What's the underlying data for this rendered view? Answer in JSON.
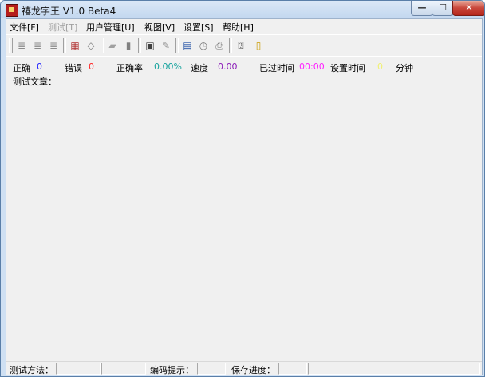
{
  "window": {
    "title": "禧龙字王 V1.0 Beta4",
    "min_glyph": "—",
    "max_glyph": "☐",
    "close_glyph": "✕"
  },
  "menu": [
    {
      "label": "文件[F]",
      "enabled": true
    },
    {
      "label": "测试[T]",
      "enabled": false
    },
    {
      "label": "用户管理[U]",
      "enabled": true
    },
    {
      "label": "视图[V]",
      "enabled": true
    },
    {
      "label": "设置[S]",
      "enabled": true
    },
    {
      "label": "帮助[H]",
      "enabled": true
    }
  ],
  "toolbar": {
    "buttons": [
      {
        "icon": "list-icon-1",
        "glyph": "≣",
        "color": "#8a8a8a"
      },
      {
        "icon": "list-icon-2",
        "glyph": "≣",
        "color": "#8a8a8a"
      },
      {
        "icon": "list-icon-3",
        "glyph": "≣",
        "color": "#8a8a8a"
      },
      {
        "icon": "open-test-icon",
        "glyph": "▦",
        "color": "#b03030"
      },
      {
        "icon": "eraser-icon",
        "glyph": "◇",
        "color": "#7a7a7a"
      },
      {
        "icon": "book-open-icon",
        "glyph": "▰",
        "color": "#a0a0a0"
      },
      {
        "icon": "books-icon",
        "glyph": "▮",
        "color": "#808080"
      },
      {
        "icon": "chart-icon",
        "glyph": "▣",
        "color": "#404040"
      },
      {
        "icon": "pen-icon",
        "glyph": "✎",
        "color": "#909090"
      },
      {
        "icon": "keyboard-icon",
        "glyph": "▤",
        "color": "#1f4fa3"
      },
      {
        "icon": "clock-icon",
        "glyph": "◷",
        "color": "#707070"
      },
      {
        "icon": "printer-icon",
        "glyph": "⎙",
        "color": "#707070"
      },
      {
        "icon": "help-pointer-icon",
        "glyph": "⍰",
        "color": "#404040"
      },
      {
        "icon": "exit-door-icon",
        "glyph": "▯",
        "color": "#c89a00"
      }
    ]
  },
  "stats": {
    "correct_label": "正确",
    "correct_value": "0",
    "error_label": "错误",
    "error_value": "0",
    "accuracy_label": "正确率",
    "accuracy_value": "0.00%",
    "speed_label": "速度",
    "speed_value": "0.00",
    "elapsed_label": "已过时间",
    "elapsed_value": "00:00",
    "settime_label": "设置时间",
    "settime_value": "0",
    "minutes_label": "分钟",
    "article_label": "测试文章："
  },
  "colors": {
    "correct": "#1a1aff",
    "error": "#ff2020",
    "accuracy": "#13a29c",
    "speed": "#8a1ab8",
    "elapsed": "#ff20ff",
    "settime": "#f0f070"
  },
  "statusbar": {
    "method_label": "测试方法：",
    "hint_label": "编码提示：",
    "progress_label": "保存进度："
  }
}
